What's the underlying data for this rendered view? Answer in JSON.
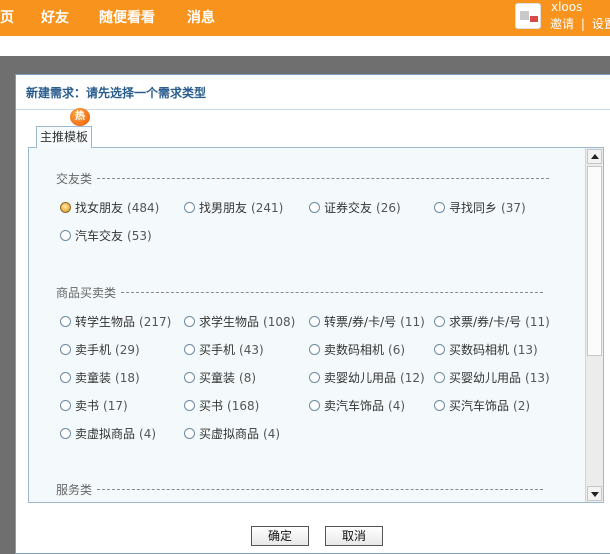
{
  "topnav": {
    "items": [
      "页",
      "好友",
      "随便看看",
      "消息"
    ]
  },
  "user": {
    "name": "xloos",
    "invite": "邀请",
    "separator": "|",
    "settings": "设置"
  },
  "dialog": {
    "title": "新建需求：请先选择一个需求类型",
    "hot_badge": "热",
    "tab_label": "主推模板",
    "confirm": "确定",
    "cancel": "取消"
  },
  "sections": [
    {
      "title": "交友类",
      "options": [
        {
          "label": "找女朋友",
          "count": "(484)",
          "checked": true
        },
        {
          "label": "找男朋友",
          "count": "(241)"
        },
        {
          "label": "证券交友",
          "count": "(26)"
        },
        {
          "label": "寻找同乡",
          "count": "(37)"
        },
        {
          "label": "汽车交友",
          "count": "(53)"
        }
      ]
    },
    {
      "title": "商品买卖类",
      "options": [
        {
          "label": "转学生物品",
          "count": "(217)"
        },
        {
          "label": "求学生物品",
          "count": "(108)"
        },
        {
          "label": "转票/券/卡/号",
          "count": "(11)"
        },
        {
          "label": "求票/券/卡/号",
          "count": "(11)"
        },
        {
          "label": "卖手机",
          "count": "(29)"
        },
        {
          "label": "买手机",
          "count": "(43)"
        },
        {
          "label": "卖数码相机",
          "count": "(6)"
        },
        {
          "label": "买数码相机",
          "count": "(13)"
        },
        {
          "label": "卖童装",
          "count": "(18)"
        },
        {
          "label": "买童装",
          "count": "(8)"
        },
        {
          "label": "卖婴幼儿用品",
          "count": "(12)"
        },
        {
          "label": "买婴幼儿用品",
          "count": "(13)"
        },
        {
          "label": "卖书",
          "count": "(17)"
        },
        {
          "label": "买书",
          "count": "(168)"
        },
        {
          "label": "卖汽车饰品",
          "count": "(4)"
        },
        {
          "label": "买汽车饰品",
          "count": "(2)"
        },
        {
          "label": "卖虚拟商品",
          "count": "(4)"
        },
        {
          "label": "买虚拟商品",
          "count": "(4)"
        }
      ]
    },
    {
      "title": "服务类",
      "options": []
    }
  ],
  "colors": {
    "topbar": "#f8941d",
    "dialog_title": "#2a5d8e",
    "panel_bg": "#f4fafc"
  }
}
